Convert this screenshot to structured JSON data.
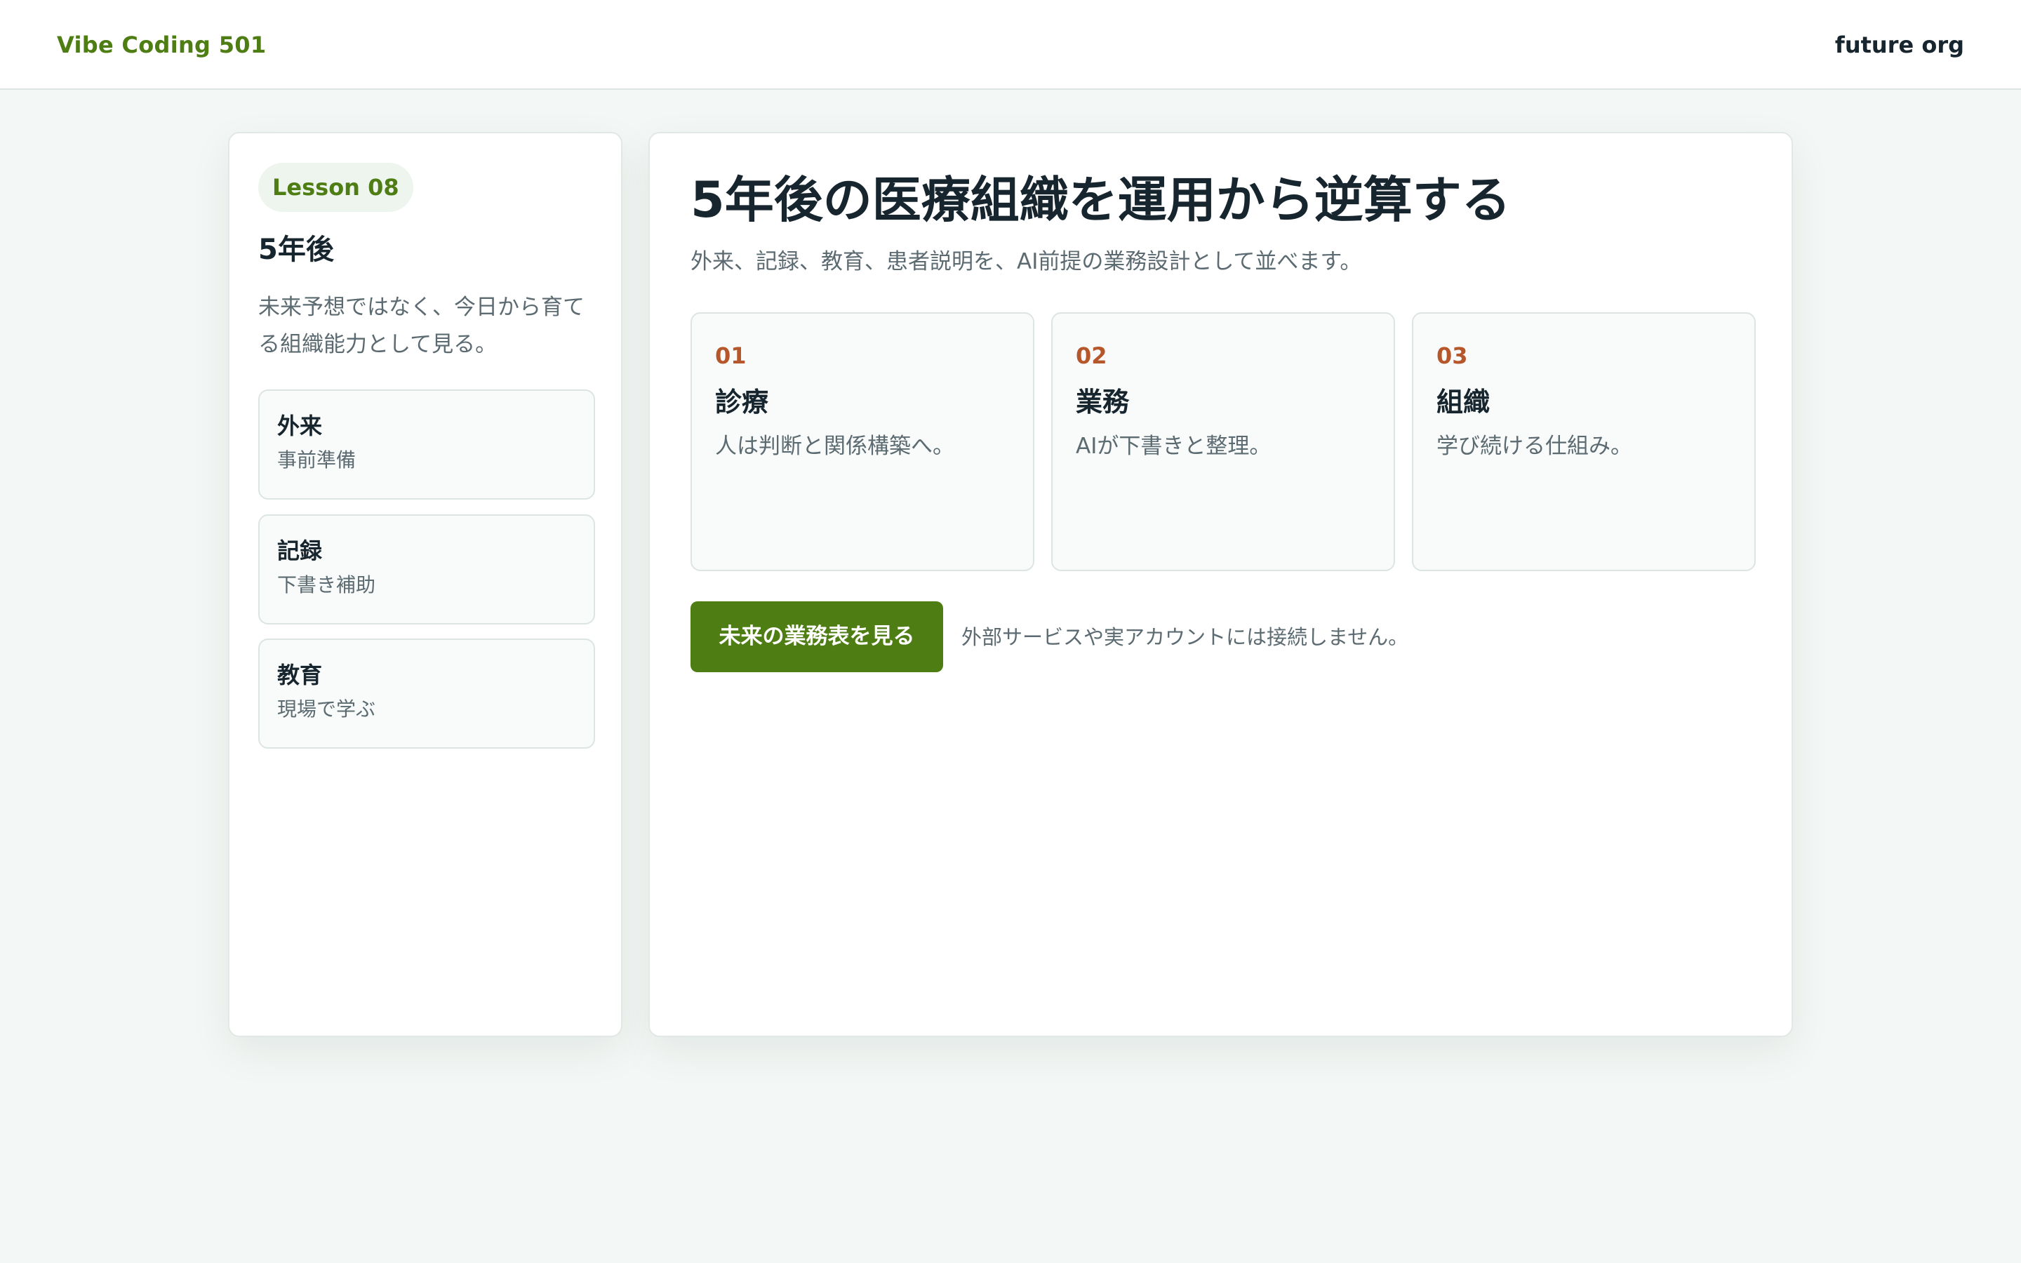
{
  "header": {
    "brand": "Vibe Coding 501",
    "org": "future org"
  },
  "sidebar": {
    "lesson_badge": "Lesson 08",
    "title": "5年後",
    "description": "未来予想ではなく、今日から育てる組織能力として見る。",
    "items": [
      {
        "title": "外来",
        "subtitle": "事前準備"
      },
      {
        "title": "記録",
        "subtitle": "下書き補助"
      },
      {
        "title": "教育",
        "subtitle": "現場で学ぶ"
      }
    ]
  },
  "main": {
    "title": "5年後の医療組織を運用から逆算する",
    "subtitle": "外来、記録、教育、患者説明を、AI前提の業務設計として並べます。",
    "cards": [
      {
        "number": "01",
        "title": "診療",
        "description": "人は判断と関係構築へ。"
      },
      {
        "number": "02",
        "title": "業務",
        "description": "AIが下書きと整理。"
      },
      {
        "number": "03",
        "title": "組織",
        "description": "学び続ける仕組み。"
      }
    ],
    "cta_label": "未来の業務表を見る",
    "note": "外部サービスや実アカウントには接続しません。"
  },
  "colors": {
    "accent": "#4e7d14",
    "number": "#b5572b",
    "background": "#f3f7f5",
    "text": "#17252e",
    "muted": "#5c6b72"
  }
}
